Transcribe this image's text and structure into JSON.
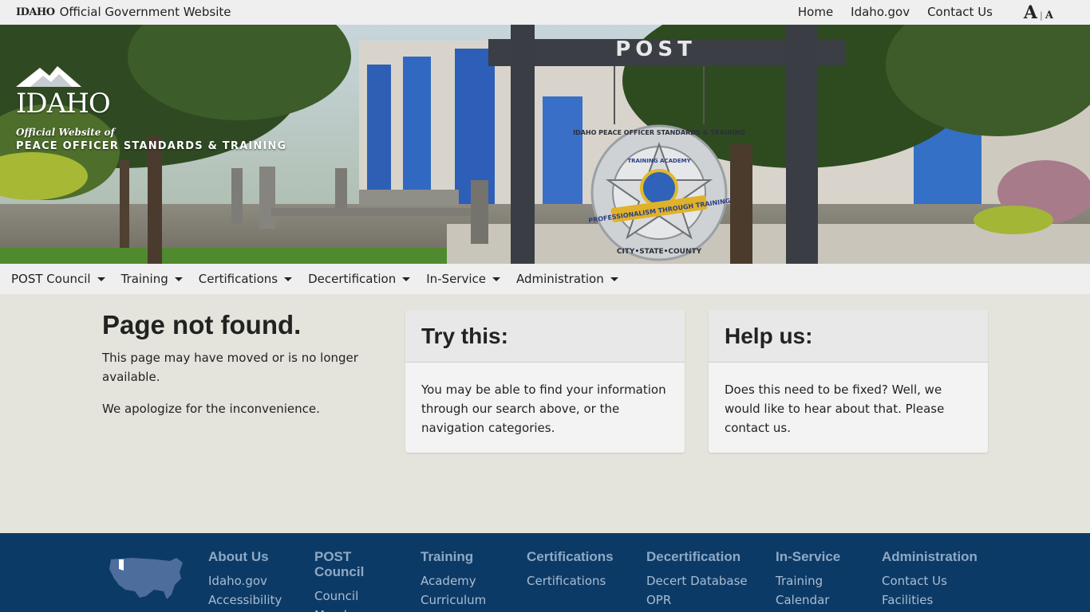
{
  "topbar": {
    "logo_text": "IDAHO",
    "site_label": "Official Government Website",
    "links": [
      "Home",
      "Idaho.gov",
      "Contact Us"
    ],
    "text_size_large": "A",
    "text_size_sep": "|",
    "text_size_small": "A"
  },
  "hero": {
    "logo_word": "IDAHO",
    "subtitle_1": "Official Website of",
    "subtitle_2": "PEACE OFFICER STANDARDS & TRAINING",
    "sign_text": "POST",
    "seal_text_top": "IDAHO PEACE OFFICER STANDARDS & TRAINING",
    "seal_text_bottom": "CITY•STATE•COUNTY",
    "seal_banner": "PROFESSIONALISM THROUGH TRAINING",
    "seal_academy": "TRAINING ACADEMY"
  },
  "nav": {
    "items": [
      "POST Council",
      "Training",
      "Certifications",
      "Decertification",
      "In-Service",
      "Administration"
    ]
  },
  "not_found": {
    "title": "Page not found.",
    "line1": "This page may have moved or is no longer available.",
    "line2": "We apologize for the inconvenience."
  },
  "try_card": {
    "title": "Try this:",
    "body": "You may be able to find your information through our search above, or the navigation categories."
  },
  "help_card": {
    "title": "Help us:",
    "body": "Does this need to be fixed? Well, we would like to hear about that. Please contact us."
  },
  "footer": {
    "columns": [
      {
        "title": "About Us",
        "links": [
          "Idaho.gov",
          "Accessibility"
        ]
      },
      {
        "title": "POST Council",
        "links": [
          "Council",
          "Members"
        ]
      },
      {
        "title": "Training",
        "links": [
          "Academy",
          "Curriculum"
        ]
      },
      {
        "title": "Certifications",
        "links": [
          "Certifications"
        ]
      },
      {
        "title": "Decertification",
        "links": [
          "Decert Database",
          "OPR"
        ]
      },
      {
        "title": "In-Service",
        "links": [
          "Training",
          "Calendar"
        ]
      },
      {
        "title": "Administration",
        "links": [
          "Contact Us",
          "Facilities"
        ]
      }
    ]
  },
  "colors": {
    "topbar_bg": "#efefef",
    "content_bg": "#e4e4dc",
    "footer_bg": "#0c3a66",
    "footer_heading": "#8fa9c4"
  }
}
